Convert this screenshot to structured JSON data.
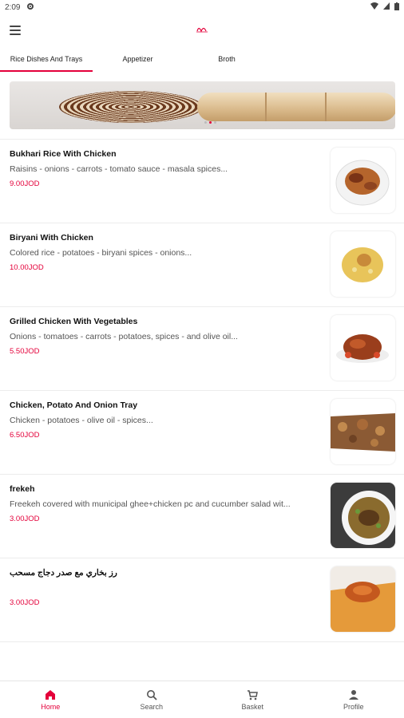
{
  "status": {
    "time": "2:09"
  },
  "tabs": [
    {
      "label": "Rice Dishes And Trays"
    },
    {
      "label": "Appetizer"
    },
    {
      "label": "Broth"
    }
  ],
  "items": [
    {
      "name": "Bukhari Rice With Chicken",
      "desc": "Raisins - onions - carrots - tomato sauce - masala spices...",
      "price": "9.00JOD"
    },
    {
      "name": "Biryani With Chicken",
      "desc": "Colored rice - potatoes - biryani spices - onions...",
      "price": "10.00JOD"
    },
    {
      "name": "Grilled Chicken With Vegetables",
      "desc": "Onions - tomatoes - carrots - potatoes, spices - and olive oil...",
      "price": "5.50JOD"
    },
    {
      "name": "Chicken, Potato And Onion Tray",
      "desc": "Chicken - potatoes - olive oil - spices...",
      "price": "6.50JOD"
    },
    {
      "name": "frekeh",
      "desc": "Freekeh covered with municipal ghee+chicken pc and cucumber salad wit...",
      "price": "3.00JOD"
    },
    {
      "name": "رز بخاري مع صدر دجاج مسحب",
      "desc": "",
      "price": "3.00JOD"
    }
  ],
  "nav": [
    {
      "label": "Home",
      "icon": "home-icon"
    },
    {
      "label": "Search",
      "icon": "search-icon"
    },
    {
      "label": "Basket",
      "icon": "cart-icon"
    },
    {
      "label": "Profile",
      "icon": "person-icon"
    }
  ],
  "colors": {
    "accent": "#e4003a"
  }
}
